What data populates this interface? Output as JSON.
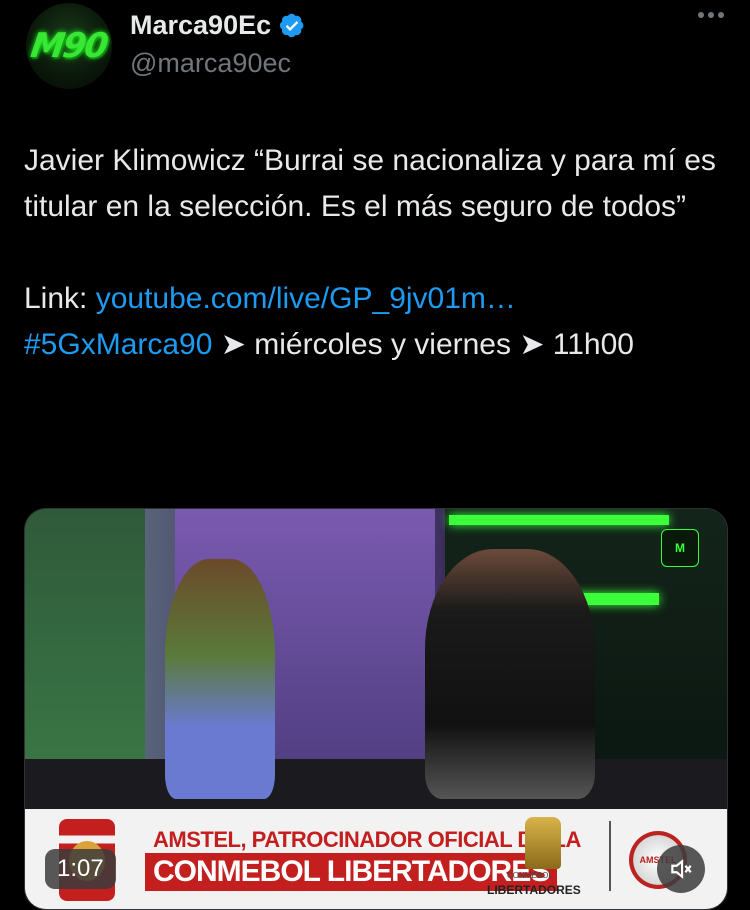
{
  "author": {
    "display_name": "Marca90Ec",
    "handle": "@marca90ec",
    "avatar_text": "M90"
  },
  "tweet": {
    "line1": "Javier Klimowicz “Burrai se nacionaliza y para mí es titular en la selección. Es el más seguro de todos”",
    "link_prefix": "Link: ",
    "link_text": "youtube.com/live/GP_9jv01m…",
    "hashtag": "#5GxMarca90",
    "schedule_text": " ➤ miércoles y viernes  ➤ 11h00"
  },
  "media": {
    "duration": "1:07",
    "watermark": "M",
    "ad_line1": "AMSTEL, PATROCINADOR OFICIAL DE LA",
    "ad_line2": "CONMEBOL LIBERTADORES",
    "ad_brand": "LIBERTADORES",
    "ad_sub": "CONMEBOL",
    "ad_can": "AMSTEL"
  },
  "colors": {
    "background": "#000000",
    "text": "#e7e9ea",
    "secondary": "#71767b",
    "link": "#1d9bf0",
    "verified": "#1d9bf0",
    "ad_red": "#c41f1f"
  }
}
